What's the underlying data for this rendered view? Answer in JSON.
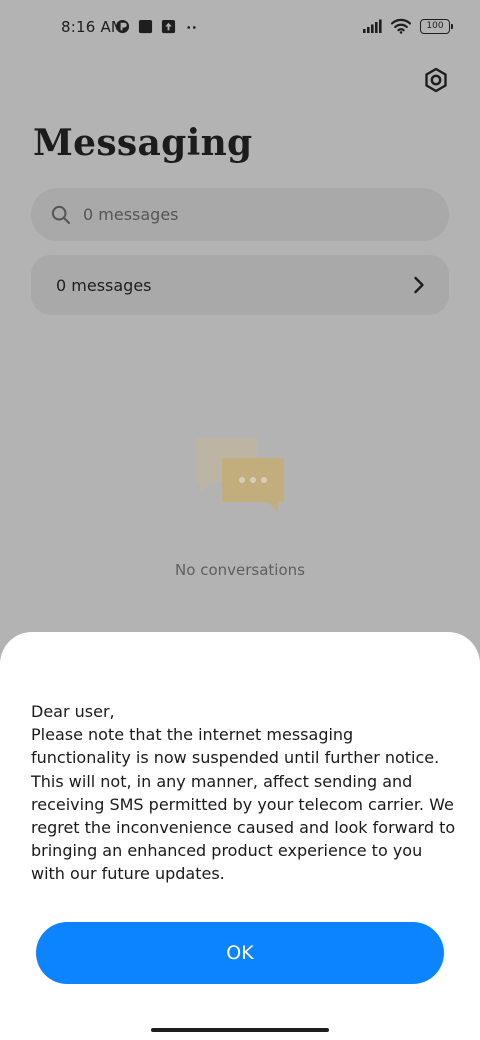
{
  "status_bar": {
    "time": "8:16 AM",
    "battery": "100",
    "icons": [
      "notification-app-icon",
      "square-notification-icon",
      "upload-notification-icon",
      "more-notifications-icon",
      "signal-icon",
      "wifi-icon",
      "battery-icon"
    ]
  },
  "header": {
    "title": "Messaging",
    "settings_icon": "settings-icon"
  },
  "search": {
    "placeholder": "0 messages"
  },
  "messages_row": {
    "label": "0 messages"
  },
  "empty_state": {
    "label": "No conversations"
  },
  "dialog": {
    "greeting": "Dear user,",
    "body": "Please note that the internet messaging functionality is now suspended until further notice. This will not, in any manner, affect sending and receiving SMS permitted by your telecom carrier. We regret the inconvenience caused and look forward to bringing an enhanced product experience to you with our future updates.",
    "ok_label": "OK"
  },
  "colors": {
    "accent": "#0d84ff",
    "overlay_bg": "#b3b3b3",
    "sheet_bg": "#ffffff"
  }
}
